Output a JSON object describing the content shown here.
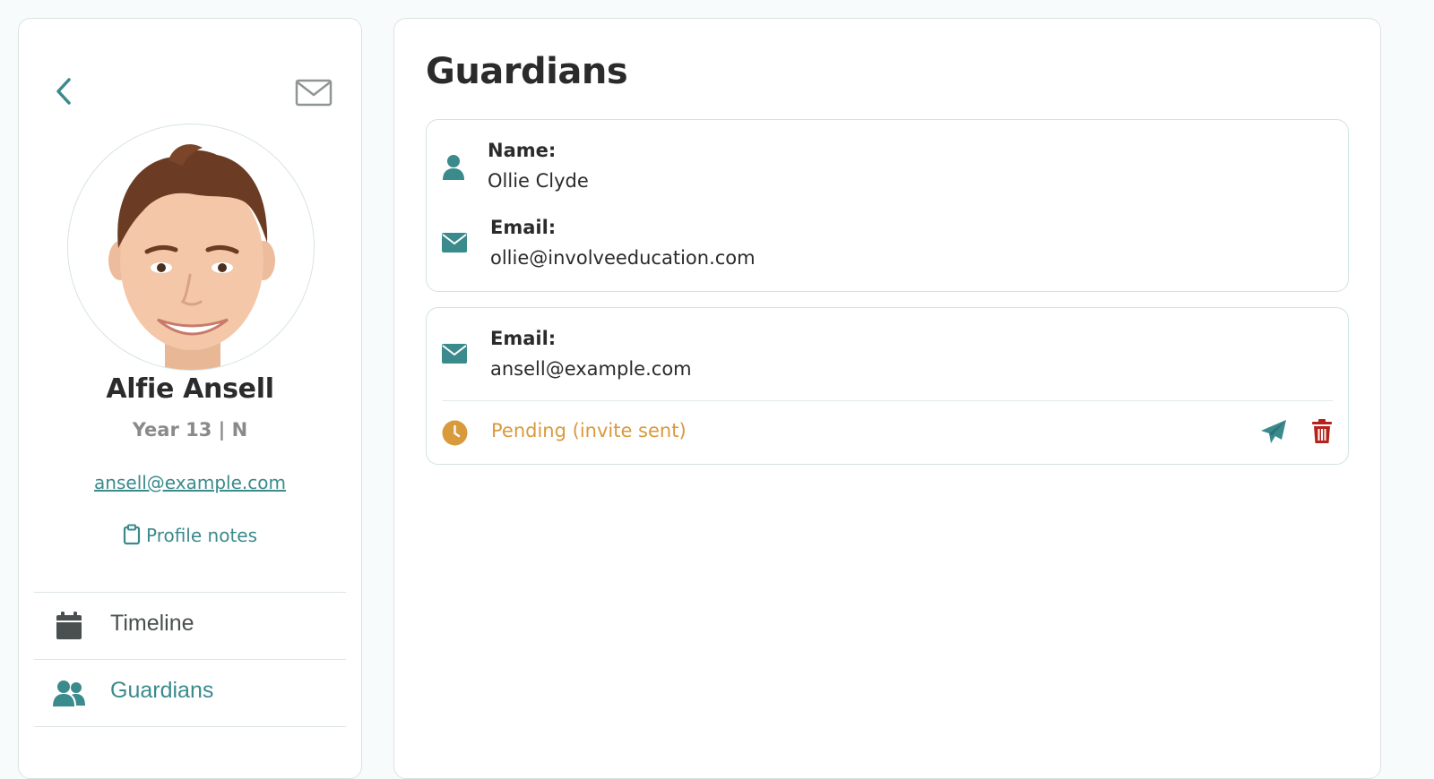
{
  "student": {
    "name": "Alfie Ansell",
    "year": "Year 13 | N",
    "email": "ansell@example.com",
    "profile_notes_label": "Profile notes"
  },
  "nav": {
    "items": [
      {
        "label": "Timeline",
        "icon": "calendar-icon",
        "active": false
      },
      {
        "label": "Guardians",
        "icon": "users-icon",
        "active": true
      }
    ]
  },
  "main": {
    "title": "Guardians",
    "guardians": [
      {
        "name_label": "Name:",
        "name": "Ollie Clyde",
        "email_label": "Email:",
        "email": "ollie@involveeducation.com"
      },
      {
        "email_label": "Email:",
        "email": "ansell@example.com",
        "status": "Pending (invite sent)"
      }
    ]
  },
  "colors": {
    "accent": "#3b8a8c",
    "pending": "#d99a3c",
    "delete": "#b5231c",
    "text": "#2b2b2b",
    "muted": "#8a8a8a"
  }
}
